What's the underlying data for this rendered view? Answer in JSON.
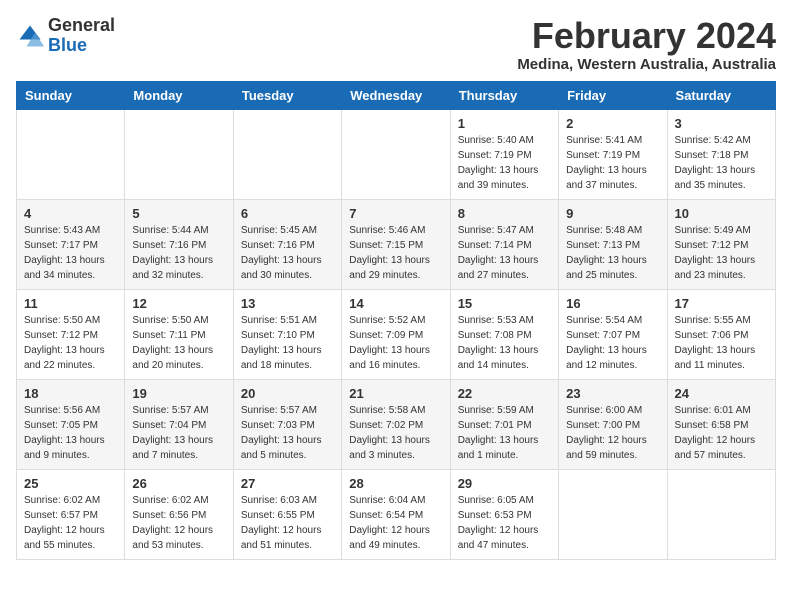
{
  "header": {
    "logo_general": "General",
    "logo_blue": "Blue",
    "month_title": "February 2024",
    "location": "Medina, Western Australia, Australia"
  },
  "weekdays": [
    "Sunday",
    "Monday",
    "Tuesday",
    "Wednesday",
    "Thursday",
    "Friday",
    "Saturday"
  ],
  "weeks": [
    [
      {
        "day": "",
        "info": ""
      },
      {
        "day": "",
        "info": ""
      },
      {
        "day": "",
        "info": ""
      },
      {
        "day": "",
        "info": ""
      },
      {
        "day": "1",
        "info": "Sunrise: 5:40 AM\nSunset: 7:19 PM\nDaylight: 13 hours\nand 39 minutes."
      },
      {
        "day": "2",
        "info": "Sunrise: 5:41 AM\nSunset: 7:19 PM\nDaylight: 13 hours\nand 37 minutes."
      },
      {
        "day": "3",
        "info": "Sunrise: 5:42 AM\nSunset: 7:18 PM\nDaylight: 13 hours\nand 35 minutes."
      }
    ],
    [
      {
        "day": "4",
        "info": "Sunrise: 5:43 AM\nSunset: 7:17 PM\nDaylight: 13 hours\nand 34 minutes."
      },
      {
        "day": "5",
        "info": "Sunrise: 5:44 AM\nSunset: 7:16 PM\nDaylight: 13 hours\nand 32 minutes."
      },
      {
        "day": "6",
        "info": "Sunrise: 5:45 AM\nSunset: 7:16 PM\nDaylight: 13 hours\nand 30 minutes."
      },
      {
        "day": "7",
        "info": "Sunrise: 5:46 AM\nSunset: 7:15 PM\nDaylight: 13 hours\nand 29 minutes."
      },
      {
        "day": "8",
        "info": "Sunrise: 5:47 AM\nSunset: 7:14 PM\nDaylight: 13 hours\nand 27 minutes."
      },
      {
        "day": "9",
        "info": "Sunrise: 5:48 AM\nSunset: 7:13 PM\nDaylight: 13 hours\nand 25 minutes."
      },
      {
        "day": "10",
        "info": "Sunrise: 5:49 AM\nSunset: 7:12 PM\nDaylight: 13 hours\nand 23 minutes."
      }
    ],
    [
      {
        "day": "11",
        "info": "Sunrise: 5:50 AM\nSunset: 7:12 PM\nDaylight: 13 hours\nand 22 minutes."
      },
      {
        "day": "12",
        "info": "Sunrise: 5:50 AM\nSunset: 7:11 PM\nDaylight: 13 hours\nand 20 minutes."
      },
      {
        "day": "13",
        "info": "Sunrise: 5:51 AM\nSunset: 7:10 PM\nDaylight: 13 hours\nand 18 minutes."
      },
      {
        "day": "14",
        "info": "Sunrise: 5:52 AM\nSunset: 7:09 PM\nDaylight: 13 hours\nand 16 minutes."
      },
      {
        "day": "15",
        "info": "Sunrise: 5:53 AM\nSunset: 7:08 PM\nDaylight: 13 hours\nand 14 minutes."
      },
      {
        "day": "16",
        "info": "Sunrise: 5:54 AM\nSunset: 7:07 PM\nDaylight: 13 hours\nand 12 minutes."
      },
      {
        "day": "17",
        "info": "Sunrise: 5:55 AM\nSunset: 7:06 PM\nDaylight: 13 hours\nand 11 minutes."
      }
    ],
    [
      {
        "day": "18",
        "info": "Sunrise: 5:56 AM\nSunset: 7:05 PM\nDaylight: 13 hours\nand 9 minutes."
      },
      {
        "day": "19",
        "info": "Sunrise: 5:57 AM\nSunset: 7:04 PM\nDaylight: 13 hours\nand 7 minutes."
      },
      {
        "day": "20",
        "info": "Sunrise: 5:57 AM\nSunset: 7:03 PM\nDaylight: 13 hours\nand 5 minutes."
      },
      {
        "day": "21",
        "info": "Sunrise: 5:58 AM\nSunset: 7:02 PM\nDaylight: 13 hours\nand 3 minutes."
      },
      {
        "day": "22",
        "info": "Sunrise: 5:59 AM\nSunset: 7:01 PM\nDaylight: 13 hours\nand 1 minute."
      },
      {
        "day": "23",
        "info": "Sunrise: 6:00 AM\nSunset: 7:00 PM\nDaylight: 12 hours\nand 59 minutes."
      },
      {
        "day": "24",
        "info": "Sunrise: 6:01 AM\nSunset: 6:58 PM\nDaylight: 12 hours\nand 57 minutes."
      }
    ],
    [
      {
        "day": "25",
        "info": "Sunrise: 6:02 AM\nSunset: 6:57 PM\nDaylight: 12 hours\nand 55 minutes."
      },
      {
        "day": "26",
        "info": "Sunrise: 6:02 AM\nSunset: 6:56 PM\nDaylight: 12 hours\nand 53 minutes."
      },
      {
        "day": "27",
        "info": "Sunrise: 6:03 AM\nSunset: 6:55 PM\nDaylight: 12 hours\nand 51 minutes."
      },
      {
        "day": "28",
        "info": "Sunrise: 6:04 AM\nSunset: 6:54 PM\nDaylight: 12 hours\nand 49 minutes."
      },
      {
        "day": "29",
        "info": "Sunrise: 6:05 AM\nSunset: 6:53 PM\nDaylight: 12 hours\nand 47 minutes."
      },
      {
        "day": "",
        "info": ""
      },
      {
        "day": "",
        "info": ""
      }
    ]
  ]
}
